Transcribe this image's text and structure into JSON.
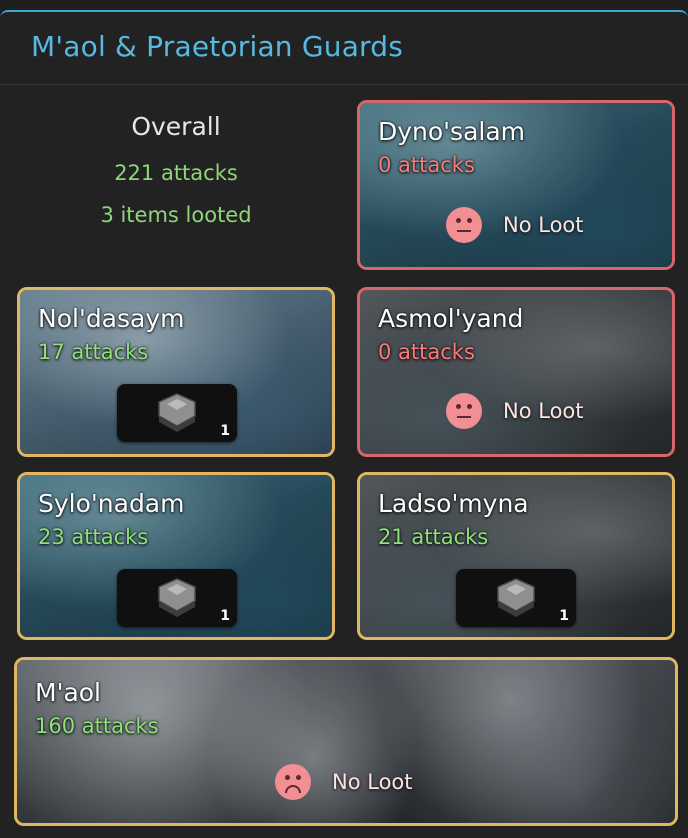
{
  "panel": {
    "title": "M'aol & Praetorian Guards"
  },
  "overall": {
    "title": "Overall",
    "attacks": "221 attacks",
    "items": "3 items looted"
  },
  "colors": {
    "accent": "#3aa7d6",
    "looted_border": "#e0b864",
    "noloot_border": "#d7676a",
    "attacks_green": "#8fe27a",
    "attacks_red": "#ff7b7b"
  },
  "cards": [
    {
      "name": "Dyno'salam",
      "attacks": "0 attacks",
      "loot": null,
      "no_loot_label": "No Loot",
      "face": "neutral-face-icon"
    },
    {
      "name": "Nol'dasaym",
      "attacks": "17 attacks",
      "loot": {
        "item": "armor-fragment-icon",
        "qty": "1"
      }
    },
    {
      "name": "Asmol'yand",
      "attacks": "0 attacks",
      "loot": null,
      "no_loot_label": "No Loot",
      "face": "neutral-face-icon"
    },
    {
      "name": "Sylo'nadam",
      "attacks": "23 attacks",
      "loot": {
        "item": "armor-fragment-icon",
        "qty": "1"
      }
    },
    {
      "name": "Ladso'myna",
      "attacks": "21 attacks",
      "loot": {
        "item": "armor-fragment-icon",
        "qty": "1"
      }
    },
    {
      "name": "M'aol",
      "attacks": "160 attacks",
      "loot": null,
      "no_loot_label": "No Loot",
      "face": "sad-face-icon"
    }
  ]
}
